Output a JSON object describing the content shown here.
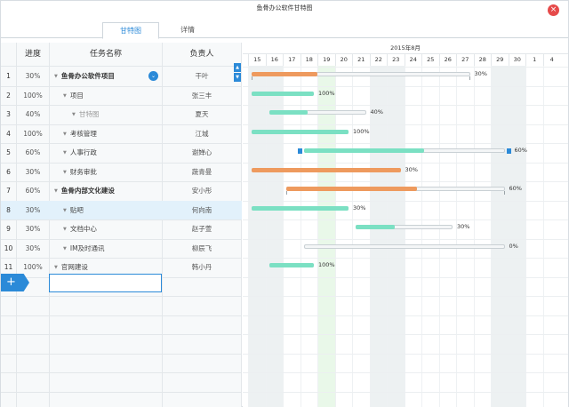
{
  "window": {
    "title": "鱼骨办公软件甘特图",
    "close_glyph": "×"
  },
  "tabs": [
    {
      "label": "甘特图",
      "active": true
    },
    {
      "label": "详情",
      "active": false
    }
  ],
  "columns": {
    "progress": "进度",
    "task": "任务名称",
    "owner": "负责人"
  },
  "rows": [
    {
      "num": "1",
      "pct": "30%",
      "name": "鱼骨办公软件项目",
      "owner": "干叶",
      "level": 0,
      "bold": true,
      "expand": true
    },
    {
      "num": "2",
      "pct": "100%",
      "name": "项目",
      "owner": "张三丰",
      "level": 1
    },
    {
      "num": "3",
      "pct": "40%",
      "name": "甘特图",
      "owner": "夏天",
      "level": 2
    },
    {
      "num": "4",
      "pct": "100%",
      "name": "考核管理",
      "owner": "江城",
      "level": 1
    },
    {
      "num": "5",
      "pct": "60%",
      "name": "人事行政",
      "owner": "谢婵心",
      "level": 1
    },
    {
      "num": "6",
      "pct": "30%",
      "name": "财务审批",
      "owner": "蔬青曼",
      "level": 1
    },
    {
      "num": "7",
      "pct": "60%",
      "name": "鱼骨内部文化建设",
      "owner": "安小彤",
      "level": 0,
      "bold": true
    },
    {
      "num": "8",
      "pct": "30%",
      "name": "贴吧",
      "owner": "何向南",
      "level": 1,
      "selected": true
    },
    {
      "num": "9",
      "pct": "30%",
      "name": "文档中心",
      "owner": "赵子萱",
      "level": 1
    },
    {
      "num": "10",
      "pct": "30%",
      "name": "IM及时通讯",
      "owner": "柳辰飞",
      "level": 1
    },
    {
      "num": "11",
      "pct": "100%",
      "name": "官网建设",
      "owner": "韩小丹",
      "level": 0,
      "plain": true
    }
  ],
  "add_button": "+",
  "new_task_input": {
    "value": "",
    "placeholder": ""
  },
  "gantt": {
    "month_label": "2015年8月",
    "days": [
      "15",
      "16",
      "17",
      "18",
      "19",
      "20",
      "21",
      "22",
      "23",
      "24",
      "25",
      "26",
      "27",
      "28",
      "29",
      "30",
      "1",
      "4"
    ],
    "weekend_days": [
      "15",
      "16",
      "22",
      "23",
      "29",
      "30"
    ],
    "today": "19",
    "bars": [
      {
        "row": 1,
        "start": "15",
        "end": "27",
        "progress": 0.3,
        "label": "30%",
        "color": "orange",
        "summary": true
      },
      {
        "row": 2,
        "start": "15",
        "end": "18",
        "progress": 1.0,
        "label": "100%",
        "color": "green"
      },
      {
        "row": 3,
        "start": "16",
        "end": "21",
        "progress": 0.4,
        "label": "40%",
        "color": "green"
      },
      {
        "row": 4,
        "start": "15",
        "end": "20",
        "progress": 1.0,
        "label": "100%",
        "color": "green"
      },
      {
        "row": 5,
        "start": "18",
        "end": "29",
        "progress": 0.6,
        "label": "60%",
        "color": "green",
        "handles": true
      },
      {
        "row": 6,
        "start": "15",
        "end": "23",
        "progress": 1.0,
        "label": "30%",
        "color": "orange"
      },
      {
        "row": 7,
        "start": "17",
        "end": "29",
        "progress": 0.6,
        "label": "60%",
        "color": "orange",
        "summary": true
      },
      {
        "row": 8,
        "start": "15",
        "end": "20",
        "progress": 1.0,
        "label": "30%",
        "color": "green"
      },
      {
        "row": 9,
        "start": "21",
        "end": "26",
        "progress": 0.4,
        "label": "30%",
        "color": "green"
      },
      {
        "row": 10,
        "start": "18",
        "end": "29",
        "progress": 0.0,
        "label": "0%",
        "color": "green"
      },
      {
        "row": 11,
        "start": "16",
        "end": "18",
        "progress": 1.0,
        "label": "100%",
        "color": "green"
      }
    ]
  }
}
